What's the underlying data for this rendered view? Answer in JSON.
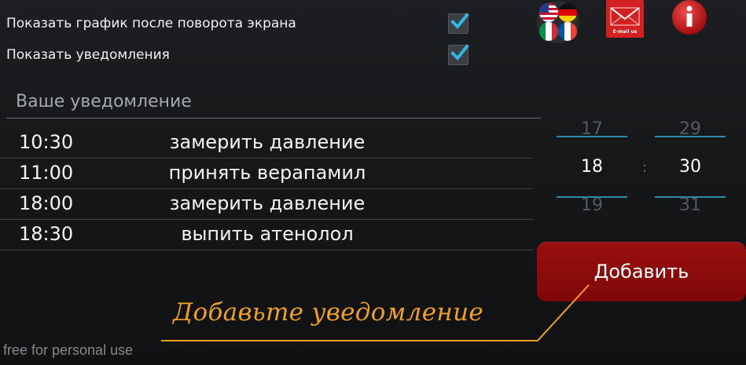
{
  "settings": {
    "show_chart_label": "Показать график после поворота экрана",
    "show_chart_checked": true,
    "show_notifications_label": "Показать уведомления",
    "show_notifications_checked": true
  },
  "notification_input": {
    "placeholder": "Ваше уведомление",
    "value": ""
  },
  "notifications": [
    {
      "time": "10:30",
      "text": "замерить давление"
    },
    {
      "time": "11:00",
      "text": "принять верапамил"
    },
    {
      "time": "18:00",
      "text": "замерить давление"
    },
    {
      "time": "18:30",
      "text": "выпить атенолол"
    }
  ],
  "time_picker": {
    "hours": {
      "prev": "17",
      "current": "18",
      "next": "19"
    },
    "minutes": {
      "prev": "29",
      "current": "30",
      "next": "31"
    },
    "separator": ":"
  },
  "add_button_label": "Добавить",
  "hint_text": "Добавьте уведомление",
  "watermark": "free for personal use",
  "icons": {
    "flags": "language-flags-icon",
    "mail": "email-icon",
    "mail_label": "E-mail us",
    "info": "info-icon"
  },
  "colors": {
    "accent": "#2f8aa8",
    "checkbox_tick": "#33b5e5",
    "add_button": "#8c0b0b",
    "hint": "#f0a020"
  }
}
